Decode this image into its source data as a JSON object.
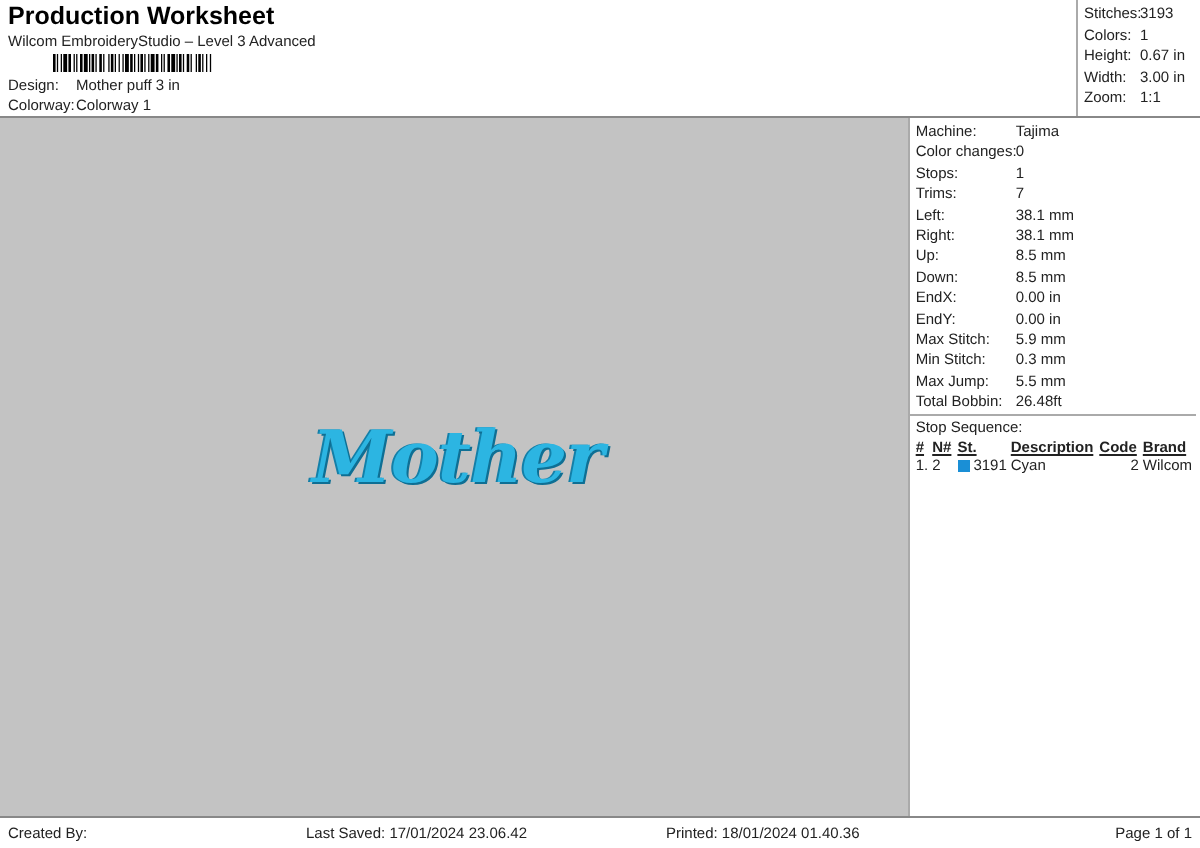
{
  "header": {
    "title": "Production Worksheet",
    "subtitle": "Wilcom EmbroideryStudio – Level 3 Advanced",
    "fields": [
      {
        "label": "Design:",
        "value": "Mother puff 3 in"
      },
      {
        "label": "Colorway:",
        "value": "Colorway 1"
      }
    ]
  },
  "summary": [
    {
      "label": "Stitches:",
      "value": "3193"
    },
    {
      "label": "Colors:",
      "value": "1"
    },
    {
      "label": "Height:",
      "value": "0.67 in"
    },
    {
      "label": "Width:",
      "value": "3.00 in"
    },
    {
      "label": "Zoom:",
      "value": "1:1"
    }
  ],
  "design_preview": {
    "text": "Mother"
  },
  "details": [
    {
      "label": "Machine:",
      "value": "Tajima"
    },
    {
      "label": "Color changes:",
      "value": "0"
    },
    {
      "label": "Stops:",
      "value": "1"
    },
    {
      "label": "Trims:",
      "value": "7"
    },
    {
      "label": "Left:",
      "value": "38.1 mm"
    },
    {
      "label": "Right:",
      "value": "38.1 mm"
    },
    {
      "label": "Up:",
      "value": "8.5 mm"
    },
    {
      "label": "Down:",
      "value": "8.5 mm"
    },
    {
      "label": "EndX:",
      "value": "0.00 in"
    },
    {
      "label": "EndY:",
      "value": "0.00 in"
    },
    {
      "label": "Max Stitch:",
      "value": "5.9 mm"
    },
    {
      "label": "Min Stitch:",
      "value": "0.3 mm"
    },
    {
      "label": "Max Jump:",
      "value": "5.5 mm"
    },
    {
      "label": "Total Bobbin:",
      "value": "26.48ft"
    }
  ],
  "stop_sequence": {
    "title": "Stop Sequence:",
    "columns": [
      "#",
      "N#",
      "St.",
      "Description",
      "Code",
      "Brand"
    ],
    "rows": [
      {
        "index": "1.",
        "needle": "2",
        "color": "#1a8fd6",
        "stitches": "3191",
        "description": "Cyan",
        "code": "2",
        "brand": "Wilcom"
      }
    ]
  },
  "footer": {
    "created_by": "Created By:",
    "last_saved": "Last Saved: 17/01/2024 23.06.42",
    "printed": "Printed: 18/01/2024 01.40.36",
    "page": "Page 1 of 1"
  }
}
